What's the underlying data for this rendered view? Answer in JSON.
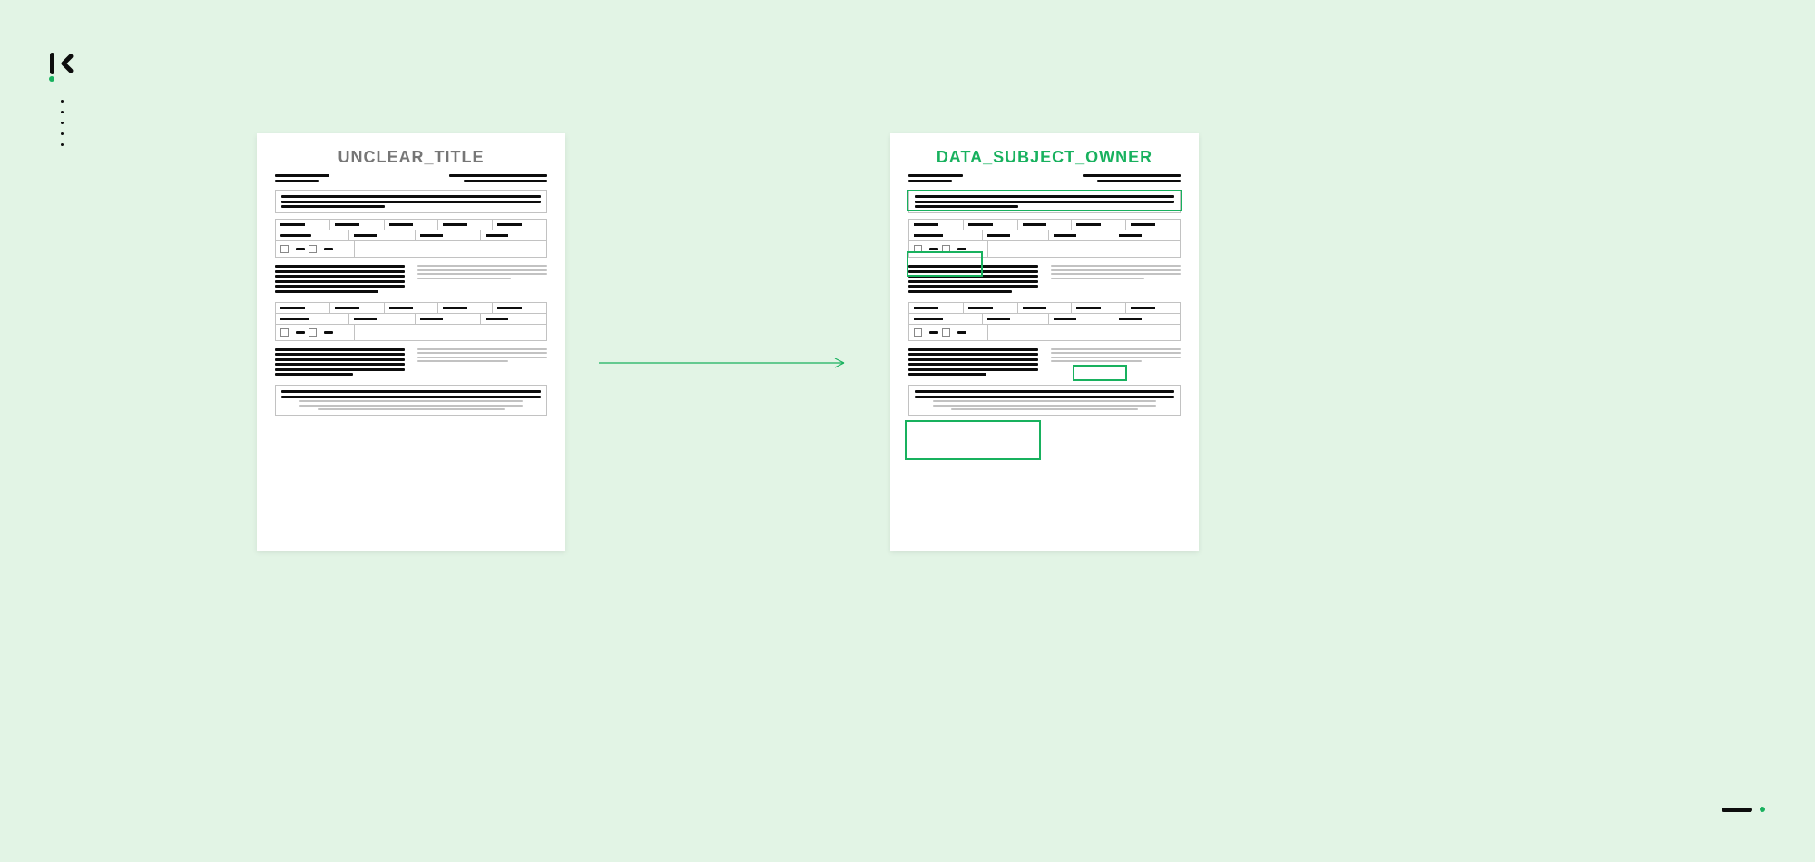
{
  "leftDoc": {
    "title": "UNCLEAR_TITLE"
  },
  "rightDoc": {
    "title": "DATA_SUBJECT_OWNER"
  }
}
